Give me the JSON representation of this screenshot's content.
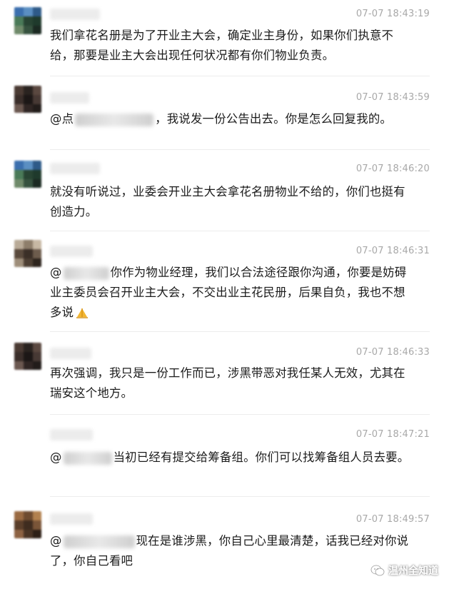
{
  "messages": [
    {
      "time": "07-07 18:43:19",
      "text": "我们拿花名册是为了开业主大会，确定业主身份，如果你们执意不给，那要是业主大会出现任何状况都有你们物业负责。",
      "avatar_colors": [
        "#3b6fae",
        "#5b8fc2",
        "#2e5a88",
        "#4a7a58",
        "#284433",
        "#1f3a2c",
        "#6f8a6a",
        "#36523f",
        "#1b2a22"
      ]
    },
    {
      "time": "07-07 18:43:59",
      "mention_prefix": "@点",
      "text": "，我说发一份公告出去。你是怎么回复我的。",
      "avatar_colors": [
        "#4a3a33",
        "#2a2320",
        "#5a4840",
        "#3a2e2a",
        "#1c1716",
        "#473934",
        "#6b5850",
        "#302624",
        "#221c1a"
      ]
    },
    {
      "time": "07-07 18:46:20",
      "text": "就没有听说过，业委会开业主大会拿花名册物业不给的，你们也挺有创造力。",
      "avatar_colors": [
        "#3b6fae",
        "#5b8fc2",
        "#2e5a88",
        "#4a7a58",
        "#284433",
        "#1f3a2c",
        "#6f8a6a",
        "#36523f",
        "#1b2a22"
      ]
    },
    {
      "time": "07-07 18:46:31",
      "mention_prefix": "@",
      "text": "你作为物业经理，我们以合法途径跟你沟通，你要是妨碍业主委员会召开业主大会，不交出业主花民册，后果自负，我也不想多说",
      "avatar_colors": [
        "#b9ab98",
        "#8e7e6b",
        "#c7b8a4",
        "#5a4a3d",
        "#3b2f27",
        "#6d5c4d",
        "#9e8e7a",
        "#4d3f33",
        "#2d241d"
      ]
    },
    {
      "time": "07-07 18:46:33",
      "text": "再次强调，我只是一份工作而已，涉黑带恶对我任某人无效，尤其在瑞安这个地方。",
      "avatar_colors": [
        "#4a3a33",
        "#2a2320",
        "#5a4840",
        "#3a2e2a",
        "#1c1716",
        "#473934",
        "#6b5850",
        "#302624",
        "#221c1a"
      ]
    },
    {
      "time": "07-07 18:47:21",
      "mention_prefix": "@",
      "text": "当初已经有提交给筹备组。你们可以找筹备组人员去要。",
      "avatar_colors": []
    },
    {
      "time": "07-07 18:49:57",
      "mention_prefix": "@",
      "text": "现在是谁涉黑，你自己心里最清楚，话我已经对你说了，你自己看吧",
      "avatar_colors": [
        "#9a6a42",
        "#6e4b30",
        "#b2814f",
        "#5a3e2a",
        "#3f2c1f",
        "#7a5538",
        "#8d6242",
        "#4a3424",
        "#2e2016"
      ]
    }
  ],
  "watermark": {
    "text": "温州全知道",
    "icon": "wechat-icon"
  }
}
